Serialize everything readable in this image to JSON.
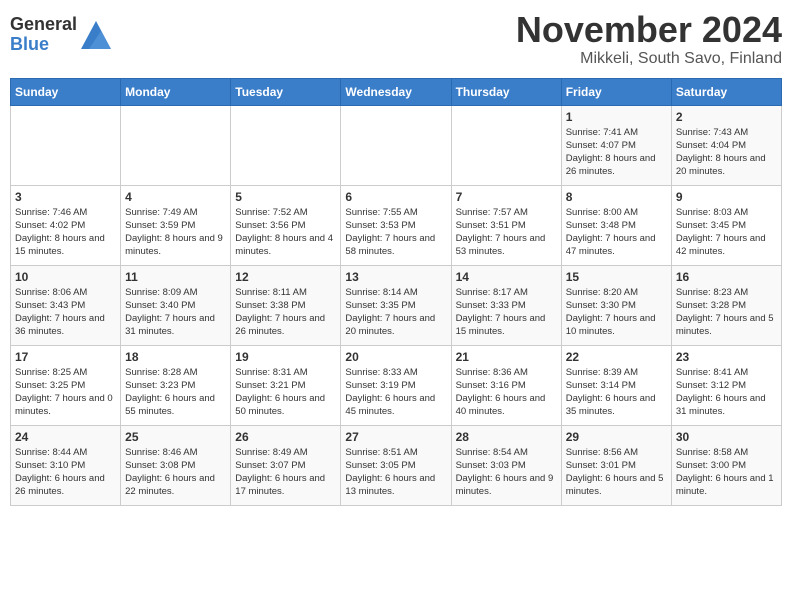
{
  "logo": {
    "general": "General",
    "blue": "Blue"
  },
  "title": "November 2024",
  "subtitle": "Mikkeli, South Savo, Finland",
  "days_header": [
    "Sunday",
    "Monday",
    "Tuesday",
    "Wednesday",
    "Thursday",
    "Friday",
    "Saturday"
  ],
  "weeks": [
    [
      {
        "day": "",
        "info": ""
      },
      {
        "day": "",
        "info": ""
      },
      {
        "day": "",
        "info": ""
      },
      {
        "day": "",
        "info": ""
      },
      {
        "day": "",
        "info": ""
      },
      {
        "day": "1",
        "info": "Sunrise: 7:41 AM\nSunset: 4:07 PM\nDaylight: 8 hours and 26 minutes."
      },
      {
        "day": "2",
        "info": "Sunrise: 7:43 AM\nSunset: 4:04 PM\nDaylight: 8 hours and 20 minutes."
      }
    ],
    [
      {
        "day": "3",
        "info": "Sunrise: 7:46 AM\nSunset: 4:02 PM\nDaylight: 8 hours and 15 minutes."
      },
      {
        "day": "4",
        "info": "Sunrise: 7:49 AM\nSunset: 3:59 PM\nDaylight: 8 hours and 9 minutes."
      },
      {
        "day": "5",
        "info": "Sunrise: 7:52 AM\nSunset: 3:56 PM\nDaylight: 8 hours and 4 minutes."
      },
      {
        "day": "6",
        "info": "Sunrise: 7:55 AM\nSunset: 3:53 PM\nDaylight: 7 hours and 58 minutes."
      },
      {
        "day": "7",
        "info": "Sunrise: 7:57 AM\nSunset: 3:51 PM\nDaylight: 7 hours and 53 minutes."
      },
      {
        "day": "8",
        "info": "Sunrise: 8:00 AM\nSunset: 3:48 PM\nDaylight: 7 hours and 47 minutes."
      },
      {
        "day": "9",
        "info": "Sunrise: 8:03 AM\nSunset: 3:45 PM\nDaylight: 7 hours and 42 minutes."
      }
    ],
    [
      {
        "day": "10",
        "info": "Sunrise: 8:06 AM\nSunset: 3:43 PM\nDaylight: 7 hours and 36 minutes."
      },
      {
        "day": "11",
        "info": "Sunrise: 8:09 AM\nSunset: 3:40 PM\nDaylight: 7 hours and 31 minutes."
      },
      {
        "day": "12",
        "info": "Sunrise: 8:11 AM\nSunset: 3:38 PM\nDaylight: 7 hours and 26 minutes."
      },
      {
        "day": "13",
        "info": "Sunrise: 8:14 AM\nSunset: 3:35 PM\nDaylight: 7 hours and 20 minutes."
      },
      {
        "day": "14",
        "info": "Sunrise: 8:17 AM\nSunset: 3:33 PM\nDaylight: 7 hours and 15 minutes."
      },
      {
        "day": "15",
        "info": "Sunrise: 8:20 AM\nSunset: 3:30 PM\nDaylight: 7 hours and 10 minutes."
      },
      {
        "day": "16",
        "info": "Sunrise: 8:23 AM\nSunset: 3:28 PM\nDaylight: 7 hours and 5 minutes."
      }
    ],
    [
      {
        "day": "17",
        "info": "Sunrise: 8:25 AM\nSunset: 3:25 PM\nDaylight: 7 hours and 0 minutes."
      },
      {
        "day": "18",
        "info": "Sunrise: 8:28 AM\nSunset: 3:23 PM\nDaylight: 6 hours and 55 minutes."
      },
      {
        "day": "19",
        "info": "Sunrise: 8:31 AM\nSunset: 3:21 PM\nDaylight: 6 hours and 50 minutes."
      },
      {
        "day": "20",
        "info": "Sunrise: 8:33 AM\nSunset: 3:19 PM\nDaylight: 6 hours and 45 minutes."
      },
      {
        "day": "21",
        "info": "Sunrise: 8:36 AM\nSunset: 3:16 PM\nDaylight: 6 hours and 40 minutes."
      },
      {
        "day": "22",
        "info": "Sunrise: 8:39 AM\nSunset: 3:14 PM\nDaylight: 6 hours and 35 minutes."
      },
      {
        "day": "23",
        "info": "Sunrise: 8:41 AM\nSunset: 3:12 PM\nDaylight: 6 hours and 31 minutes."
      }
    ],
    [
      {
        "day": "24",
        "info": "Sunrise: 8:44 AM\nSunset: 3:10 PM\nDaylight: 6 hours and 26 minutes."
      },
      {
        "day": "25",
        "info": "Sunrise: 8:46 AM\nSunset: 3:08 PM\nDaylight: 6 hours and 22 minutes."
      },
      {
        "day": "26",
        "info": "Sunrise: 8:49 AM\nSunset: 3:07 PM\nDaylight: 6 hours and 17 minutes."
      },
      {
        "day": "27",
        "info": "Sunrise: 8:51 AM\nSunset: 3:05 PM\nDaylight: 6 hours and 13 minutes."
      },
      {
        "day": "28",
        "info": "Sunrise: 8:54 AM\nSunset: 3:03 PM\nDaylight: 6 hours and 9 minutes."
      },
      {
        "day": "29",
        "info": "Sunrise: 8:56 AM\nSunset: 3:01 PM\nDaylight: 6 hours and 5 minutes."
      },
      {
        "day": "30",
        "info": "Sunrise: 8:58 AM\nSunset: 3:00 PM\nDaylight: 6 hours and 1 minute."
      }
    ]
  ]
}
